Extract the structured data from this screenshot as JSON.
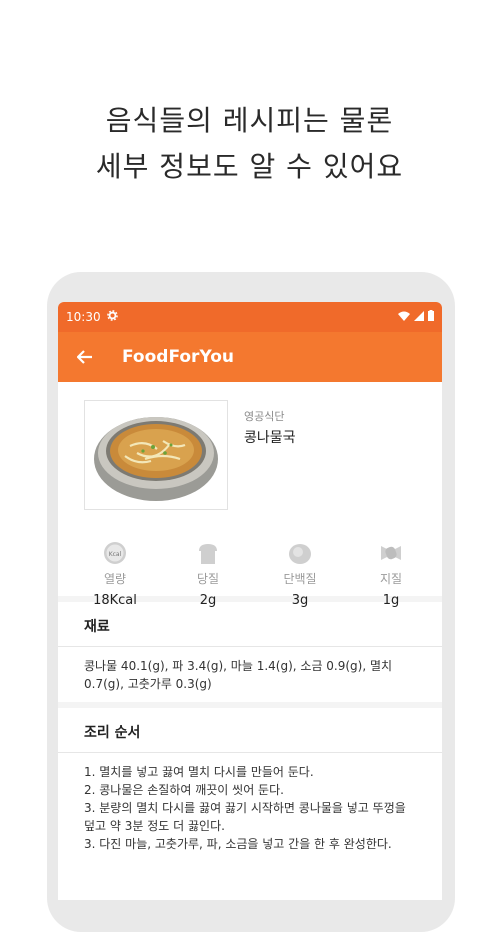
{
  "headline": {
    "line1": "음식들의 레시피는 물론",
    "line2": "세부 정보도 알 수 있어요"
  },
  "statusbar": {
    "time": "10:30"
  },
  "appbar": {
    "title": "FoodForYou"
  },
  "food": {
    "category": "영공식단",
    "name": "콩나물국"
  },
  "nutrition": [
    {
      "label": "열량",
      "value": "18Kcal",
      "icon": "kcal-icon"
    },
    {
      "label": "당질",
      "value": "2g",
      "icon": "bread-icon"
    },
    {
      "label": "단백질",
      "value": "3g",
      "icon": "egg-icon"
    },
    {
      "label": "지질",
      "value": "1g",
      "icon": "candy-icon"
    }
  ],
  "ingredients": {
    "title": "재료",
    "text": "콩나물 40.1(g), 파 3.4(g), 마늘 1.4(g), 소금 0.9(g), 멸치 0.7(g), 고춧가루 0.3(g)"
  },
  "steps": {
    "title": "조리 순서",
    "items": [
      "1. 멸치를 넣고 끓여 멸치 다시를 만들어 둔다.",
      "2. 콩나물은 손질하여 깨끗이 씻어 둔다.",
      "3. 분량의 멸치 다시를 끓여 끓기 시작하면 콩나물을 넣고 뚜껑을 덮고 약 3분 정도 더 끓인다.",
      "3. 다진 마늘, 고춧가루, 파, 소금을 넣고 간을 한 후 완성한다."
    ]
  },
  "colors": {
    "accent": "#f4782f",
    "statusbar": "#f06a2a"
  }
}
